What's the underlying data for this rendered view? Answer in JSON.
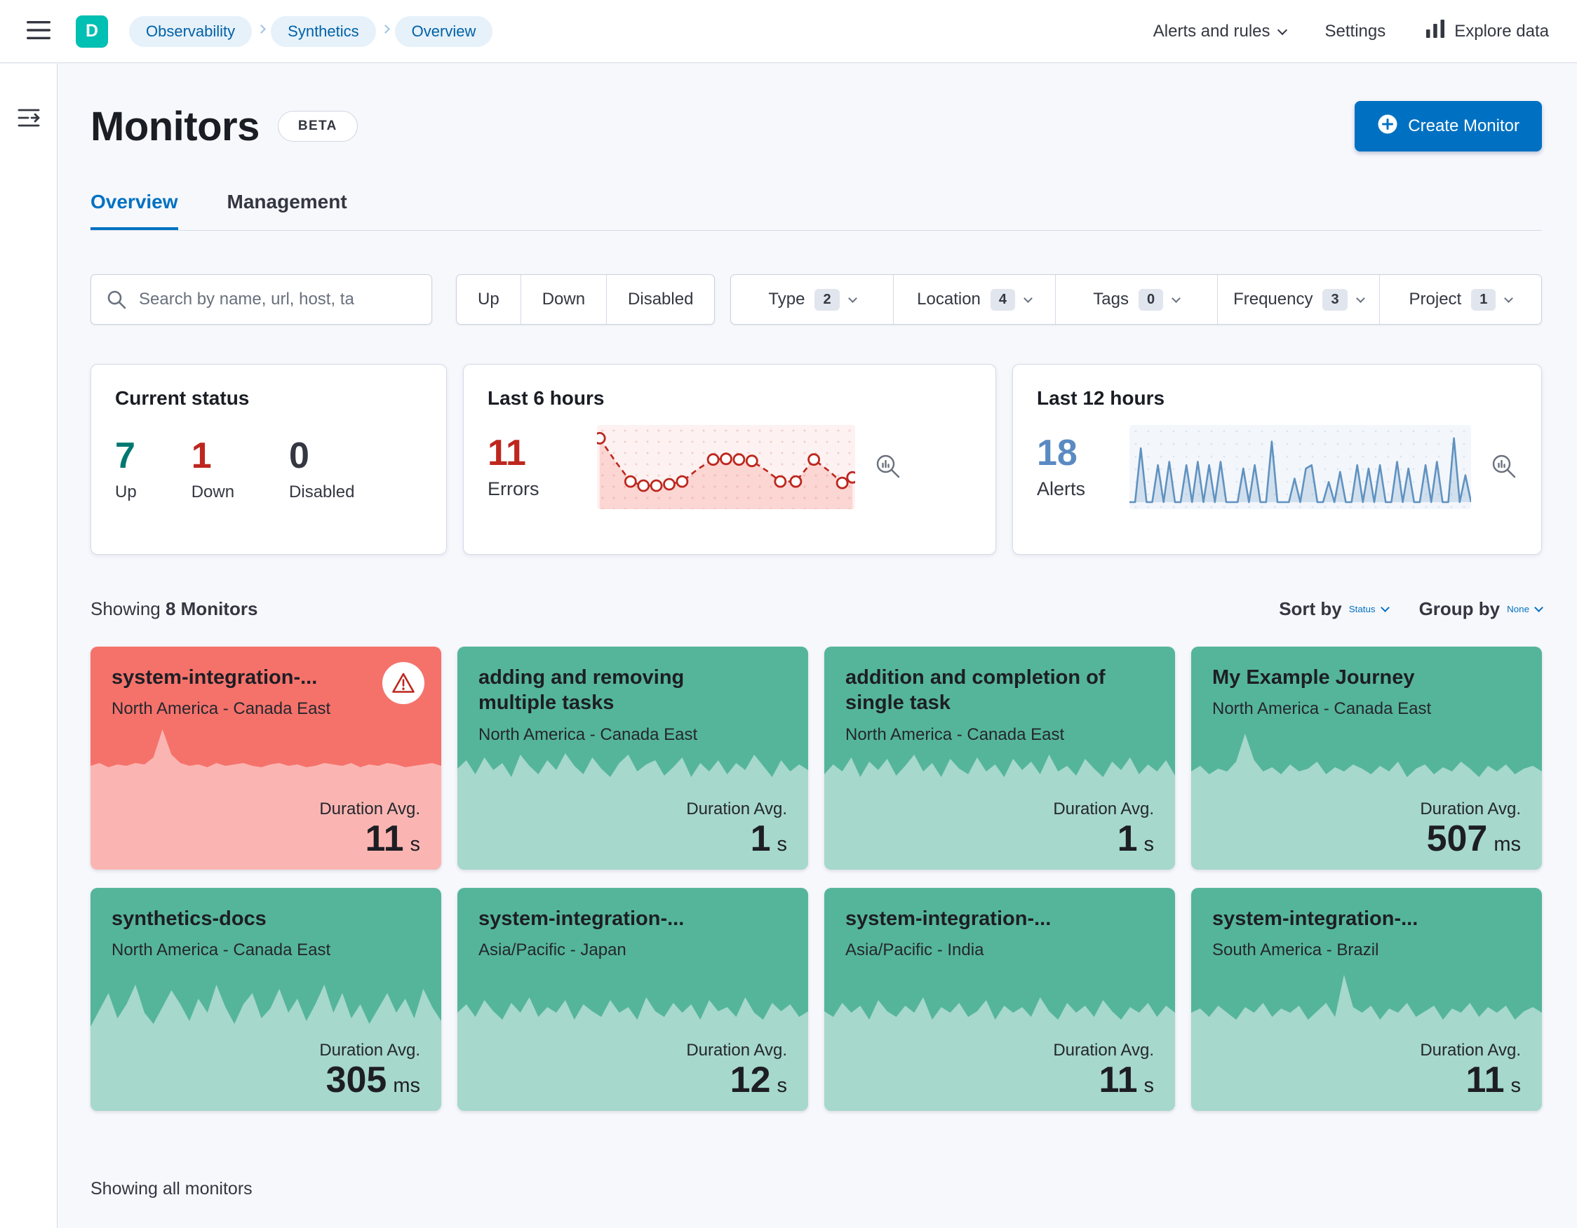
{
  "topbar": {
    "avatar_letter": "D",
    "breadcrumbs": [
      "Observability",
      "Synthetics",
      "Overview"
    ],
    "alerts_and_rules": "Alerts and rules",
    "settings": "Settings",
    "explore_data": "Explore data"
  },
  "page": {
    "title": "Monitors",
    "beta_badge": "BETA",
    "create_monitor": "Create Monitor",
    "tabs": {
      "overview": "Overview",
      "management": "Management"
    },
    "showing_prefix": "Showing",
    "monitor_count": "8 Monitors",
    "sort_by_label": "Sort by",
    "sort_by_value": "Status",
    "group_by_label": "Group by",
    "group_by_value": "None",
    "duration_label": "Duration Avg.",
    "footer_text": "Showing all monitors"
  },
  "filters": {
    "search_placeholder": "Search by name, url, host, ta",
    "status_buttons": [
      "Up",
      "Down",
      "Disabled"
    ],
    "dropdowns": [
      {
        "label": "Type",
        "count": "2"
      },
      {
        "label": "Location",
        "count": "4"
      },
      {
        "label": "Tags",
        "count": "0"
      },
      {
        "label": "Frequency",
        "count": "3"
      },
      {
        "label": "Project",
        "count": "1"
      }
    ]
  },
  "stats": {
    "current_status": {
      "title": "Current status",
      "items": [
        {
          "value": "7",
          "label": "Up",
          "color": "#007871"
        },
        {
          "value": "1",
          "label": "Down",
          "color": "#bd271e"
        },
        {
          "value": "0",
          "label": "Disabled",
          "color": "#343741"
        }
      ]
    },
    "last_6_hours": {
      "title": "Last 6 hours",
      "value": "11",
      "label": "Errors"
    },
    "last_12_hours": {
      "title": "Last 12 hours",
      "value": "18",
      "label": "Alerts"
    }
  },
  "colors": {
    "accent_blue": "#0071c2",
    "up_green": "#55b59b",
    "down_red": "#f5726b",
    "danger_text": "#bd271e",
    "success_text": "#007871",
    "alerts_blue": "#6092c0"
  },
  "monitors": [
    {
      "name": "system-integration-...",
      "location": "North America - Canada East",
      "duration": "11",
      "unit": "s",
      "status": "down",
      "spark": [
        0.74,
        0.76,
        0.73,
        0.75,
        0.74,
        0.76,
        0.75,
        0.8,
        1.0,
        0.82,
        0.76,
        0.74,
        0.75,
        0.73,
        0.76,
        0.74,
        0.75,
        0.76,
        0.74,
        0.73,
        0.75,
        0.76,
        0.74,
        0.75,
        0.73,
        0.74,
        0.76,
        0.75,
        0.74,
        0.76,
        0.73,
        0.75,
        0.74,
        0.76,
        0.75,
        0.73,
        0.74,
        0.75,
        0.76,
        0.74
      ]
    },
    {
      "name": "adding and removing multiple tasks",
      "location": "North America - Canada East",
      "duration": "1",
      "unit": "s",
      "status": "up",
      "spark": [
        0.72,
        0.78,
        0.68,
        0.8,
        0.71,
        0.76,
        0.66,
        0.82,
        0.74,
        0.68,
        0.78,
        0.71,
        0.83,
        0.74,
        0.68,
        0.8,
        0.72,
        0.66,
        0.76,
        0.82,
        0.7,
        0.75,
        0.78,
        0.67,
        0.73,
        0.8,
        0.66,
        0.76,
        0.7,
        0.78,
        0.68,
        0.76,
        0.71,
        0.82,
        0.74,
        0.66,
        0.78,
        0.7,
        0.75,
        0.71
      ]
    },
    {
      "name": "addition and completion of single task",
      "location": "North America - Canada East",
      "duration": "1",
      "unit": "s",
      "status": "up",
      "spark": [
        0.68,
        0.75,
        0.7,
        0.8,
        0.66,
        0.77,
        0.71,
        0.79,
        0.67,
        0.74,
        0.82,
        0.7,
        0.76,
        0.66,
        0.79,
        0.72,
        0.68,
        0.8,
        0.7,
        0.75,
        0.66,
        0.79,
        0.71,
        0.77,
        0.68,
        0.82,
        0.7,
        0.74,
        0.67,
        0.79,
        0.72,
        0.66,
        0.77,
        0.71,
        0.8,
        0.68,
        0.75,
        0.7,
        0.78,
        0.67
      ]
    },
    {
      "name": "My Example Journey",
      "location": "North America - Canada East",
      "duration": "507",
      "unit": "ms",
      "status": "up",
      "spark": [
        0.7,
        0.74,
        0.68,
        0.72,
        0.7,
        0.77,
        0.97,
        0.78,
        0.7,
        0.73,
        0.68,
        0.75,
        0.7,
        0.72,
        0.77,
        0.68,
        0.73,
        0.7,
        0.75,
        0.72,
        0.68,
        0.74,
        0.7,
        0.77,
        0.66,
        0.72,
        0.75,
        0.68,
        0.73,
        0.7,
        0.77,
        0.72,
        0.66,
        0.74,
        0.7,
        0.75,
        0.68,
        0.72,
        0.74,
        0.7
      ]
    },
    {
      "name": "synthetics-docs",
      "location": "North America - Canada East",
      "duration": "305",
      "unit": "ms",
      "status": "up",
      "spark": [
        0.6,
        0.72,
        0.84,
        0.66,
        0.76,
        0.9,
        0.7,
        0.62,
        0.74,
        0.86,
        0.76,
        0.64,
        0.8,
        0.7,
        0.9,
        0.74,
        0.62,
        0.76,
        0.84,
        0.66,
        0.73,
        0.87,
        0.7,
        0.8,
        0.64,
        0.76,
        0.9,
        0.7,
        0.84,
        0.66,
        0.76,
        0.62,
        0.73,
        0.84,
        0.7,
        0.8,
        0.66,
        0.87,
        0.74,
        0.64
      ]
    },
    {
      "name": "system-integration-...",
      "location": "Asia/Pacific - Japan",
      "duration": "12",
      "unit": "s",
      "status": "up",
      "spark": [
        0.7,
        0.76,
        0.67,
        0.79,
        0.71,
        0.65,
        0.77,
        0.7,
        0.81,
        0.67,
        0.74,
        0.7,
        0.79,
        0.65,
        0.76,
        0.71,
        0.67,
        0.79,
        0.7,
        0.74,
        0.65,
        0.81,
        0.71,
        0.67,
        0.77,
        0.7,
        0.76,
        0.65,
        0.79,
        0.71,
        0.74,
        0.67,
        0.81,
        0.7,
        0.65,
        0.77,
        0.71,
        0.76,
        0.67,
        0.71
      ]
    },
    {
      "name": "system-integration-...",
      "location": "Asia/Pacific - India",
      "duration": "11",
      "unit": "s",
      "status": "up",
      "spark": [
        0.71,
        0.67,
        0.77,
        0.7,
        0.75,
        0.65,
        0.79,
        0.71,
        0.67,
        0.75,
        0.7,
        0.81,
        0.65,
        0.74,
        0.7,
        0.77,
        0.67,
        0.71,
        0.79,
        0.65,
        0.75,
        0.7,
        0.74,
        0.67,
        0.81,
        0.71,
        0.65,
        0.77,
        0.7,
        0.75,
        0.67,
        0.79,
        0.71,
        0.65,
        0.74,
        0.7,
        0.77,
        0.67,
        0.75,
        0.7
      ]
    },
    {
      "name": "system-integration-...",
      "location": "South America - Brazil",
      "duration": "11",
      "unit": "s",
      "status": "up",
      "spark": [
        0.7,
        0.73,
        0.67,
        0.75,
        0.7,
        0.65,
        0.74,
        0.7,
        0.77,
        0.67,
        0.73,
        0.7,
        0.75,
        0.65,
        0.71,
        0.77,
        0.67,
        0.97,
        0.74,
        0.7,
        0.75,
        0.65,
        0.73,
        0.7,
        0.77,
        0.67,
        0.71,
        0.75,
        0.65,
        0.73,
        0.7,
        0.77,
        0.67,
        0.74,
        0.7,
        0.75,
        0.65,
        0.71,
        0.74,
        0.7
      ]
    }
  ],
  "chart_data": [
    {
      "id": "errors-last-6-hours",
      "type": "line",
      "title": "Last 6 hours",
      "metric_label": "Errors",
      "metric_value": 11,
      "color": "#bd271e",
      "style": "dashed-with-markers",
      "points": [
        {
          "x": 1,
          "y": 0.93,
          "m": true
        },
        {
          "x": 7,
          "y": 0.6,
          "m": false
        },
        {
          "x": 13,
          "y": 0.3,
          "m": true
        },
        {
          "x": 18,
          "y": 0.24,
          "m": true
        },
        {
          "x": 23,
          "y": 0.24,
          "m": true
        },
        {
          "x": 28,
          "y": 0.26,
          "m": true
        },
        {
          "x": 33,
          "y": 0.3,
          "m": true
        },
        {
          "x": 39,
          "y": 0.48,
          "m": false
        },
        {
          "x": 45,
          "y": 0.62,
          "m": true
        },
        {
          "x": 50,
          "y": 0.63,
          "m": true
        },
        {
          "x": 55,
          "y": 0.62,
          "m": true
        },
        {
          "x": 60,
          "y": 0.6,
          "m": true
        },
        {
          "x": 66,
          "y": 0.45,
          "m": false
        },
        {
          "x": 71,
          "y": 0.3,
          "m": true
        },
        {
          "x": 77,
          "y": 0.3,
          "m": true
        },
        {
          "x": 84,
          "y": 0.62,
          "m": true
        },
        {
          "x": 90,
          "y": 0.45,
          "m": false
        },
        {
          "x": 95,
          "y": 0.28,
          "m": true
        },
        {
          "x": 99,
          "y": 0.36,
          "m": true
        }
      ]
    },
    {
      "id": "alerts-last-12-hours",
      "type": "area",
      "title": "Last 12 hours",
      "metric_label": "Alerts",
      "metric_value": 18,
      "color": "#6092c0",
      "values": [
        0,
        0,
        0.8,
        0,
        0,
        0.55,
        0,
        0.6,
        0,
        0,
        0.55,
        0,
        0.6,
        0,
        0.55,
        0,
        0.6,
        0,
        0,
        0,
        0.5,
        0,
        0.55,
        0,
        0,
        0.9,
        0,
        0,
        0,
        0.35,
        0,
        0.5,
        0.55,
        0,
        0,
        0.3,
        0,
        0.45,
        0,
        0,
        0.55,
        0,
        0.5,
        0,
        0.55,
        0,
        0,
        0.6,
        0,
        0.5,
        0,
        0,
        0.55,
        0,
        0.6,
        0,
        0,
        0.95,
        0,
        0.4,
        0
      ]
    }
  ]
}
